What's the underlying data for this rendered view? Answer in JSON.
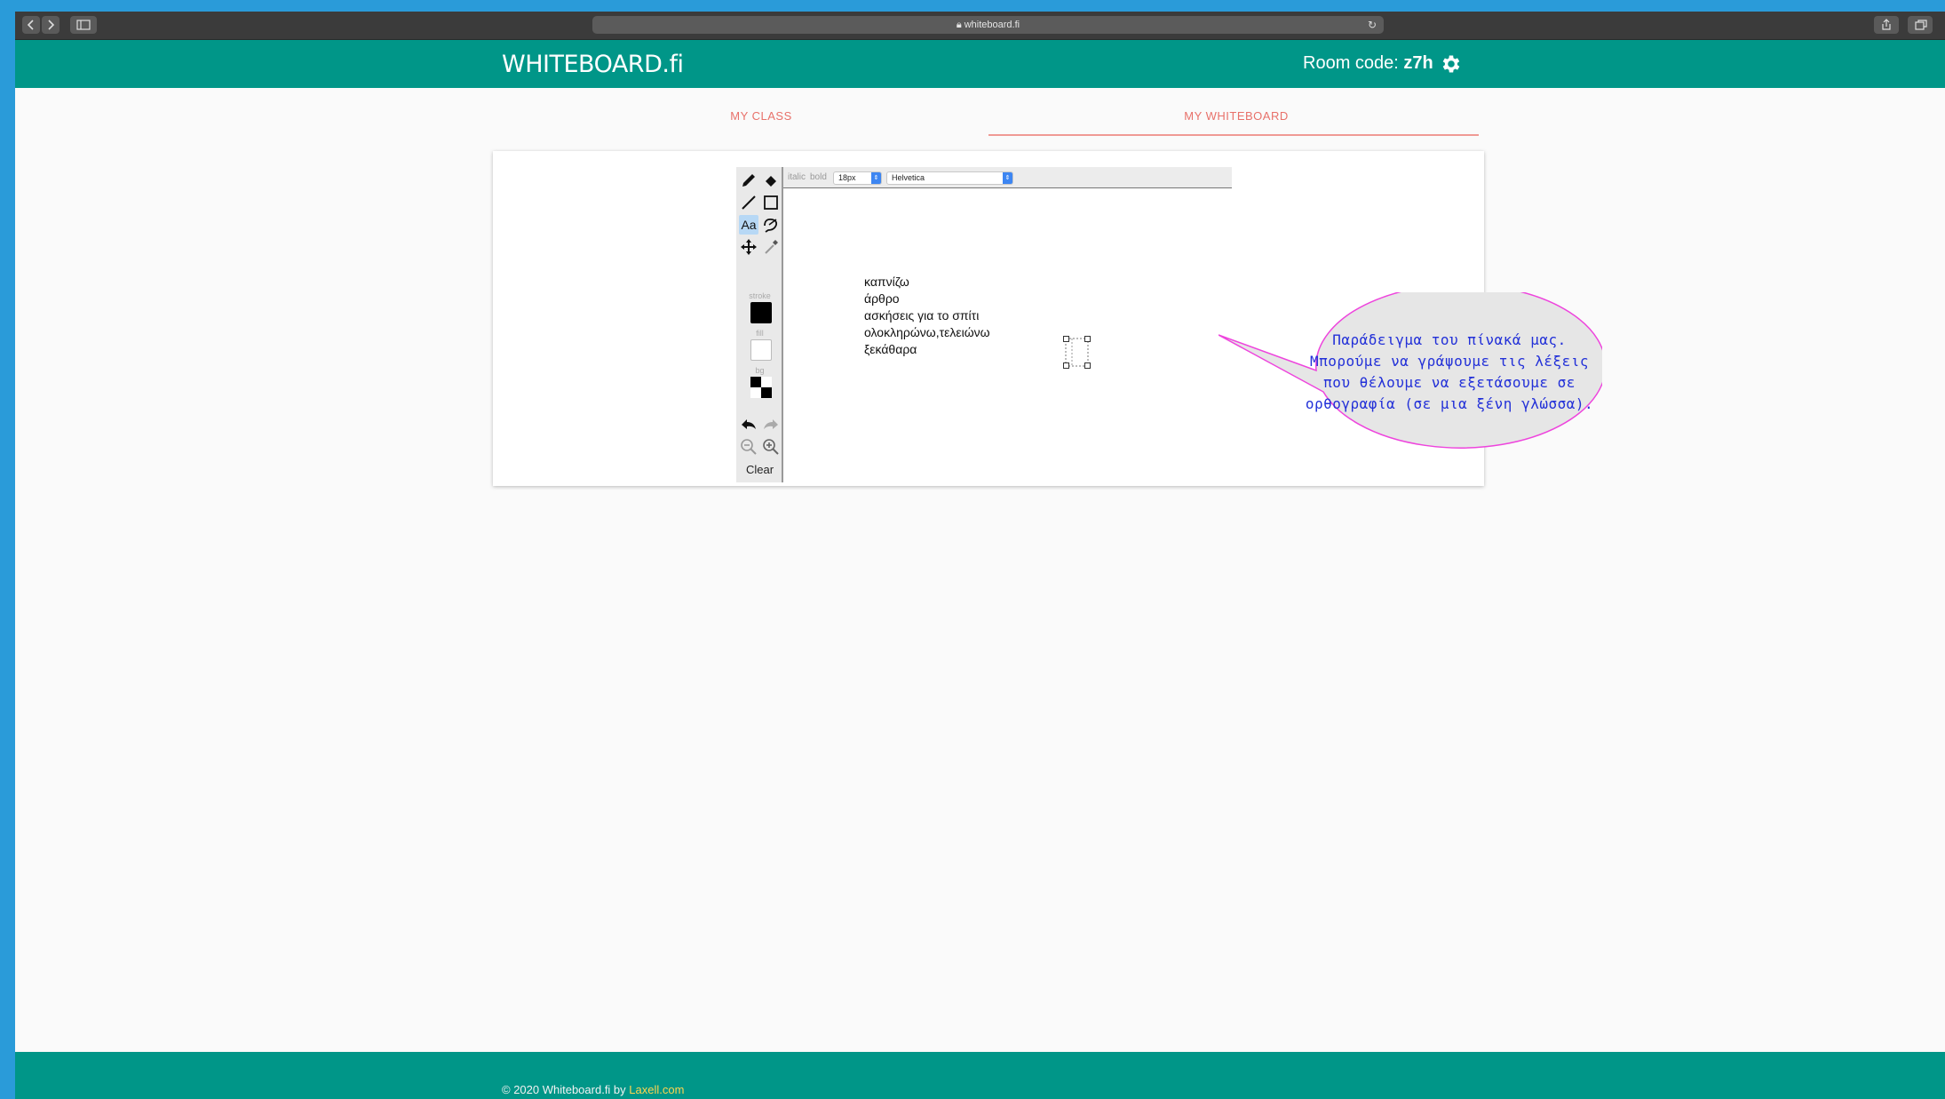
{
  "browser": {
    "url": "whiteboard.fi"
  },
  "header": {
    "logo": "WHITEBOARD.fi",
    "room_label": "Room code: ",
    "room_code": "z7h"
  },
  "tabs": [
    {
      "label": "MY CLASS",
      "active": false
    },
    {
      "label": "MY WHITEBOARD",
      "active": true
    }
  ],
  "toolbar": {
    "active_tool": "text",
    "text_tool_label": "Aa",
    "stroke_label": "stroke",
    "fill_label": "fill",
    "bg_label": "bg",
    "stroke_color": "#000000",
    "fill_color": "#ffffff",
    "clear_label": "Clear"
  },
  "fontbar": {
    "italic_label": "italic",
    "bold_label": "bold",
    "size": "18px",
    "font": "Helvetica"
  },
  "canvas": {
    "lines": [
      "καπνίζω",
      "άρθρο",
      "ασκήσεις για το σπίτι",
      "ολοκληρώνω,τελειώνω",
      "ξεκάθαρα"
    ]
  },
  "callout": {
    "lines": [
      "Παράδειγμα του πίνακά μας.",
      "Μπορούμε να γράψουμε τις λέξεις",
      "που θέλουμε να εξετάσουμε σε",
      "ορθογραφία (σε μια ξένη γλώσσα)."
    ],
    "fill": "#e6e6e6",
    "border": "#ee44dd",
    "text_color": "#2230d8"
  },
  "footer": {
    "copyright": "© 2020 Whiteboard.fi by ",
    "link": "Laxell.com"
  },
  "colors": {
    "brand": "#009688",
    "tab_accent": "#e8716a",
    "link": "#ffd54f"
  }
}
